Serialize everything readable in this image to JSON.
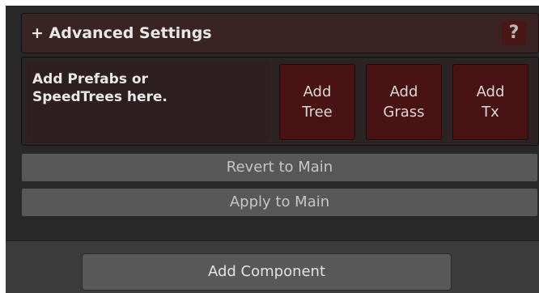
{
  "advanced_settings": {
    "title": "+ Advanced Settings",
    "help_label": "?"
  },
  "drop_area": {
    "text": "Add Prefabs or\nSpeedTrees here.",
    "buttons": [
      {
        "label": "Add\nTree",
        "icon": "none"
      },
      {
        "label": "Add\nGrass",
        "icon": "none"
      },
      {
        "label": "Add\nTx",
        "icon": "none"
      }
    ]
  },
  "actions": {
    "revert_label": "Revert to Main",
    "apply_label": "Apply to Main"
  },
  "footer": {
    "add_component_label": "Add Component"
  },
  "colors": {
    "accent_button": "#4a1313",
    "header_bg": "#3a2323",
    "neutral_button": "#585858"
  }
}
